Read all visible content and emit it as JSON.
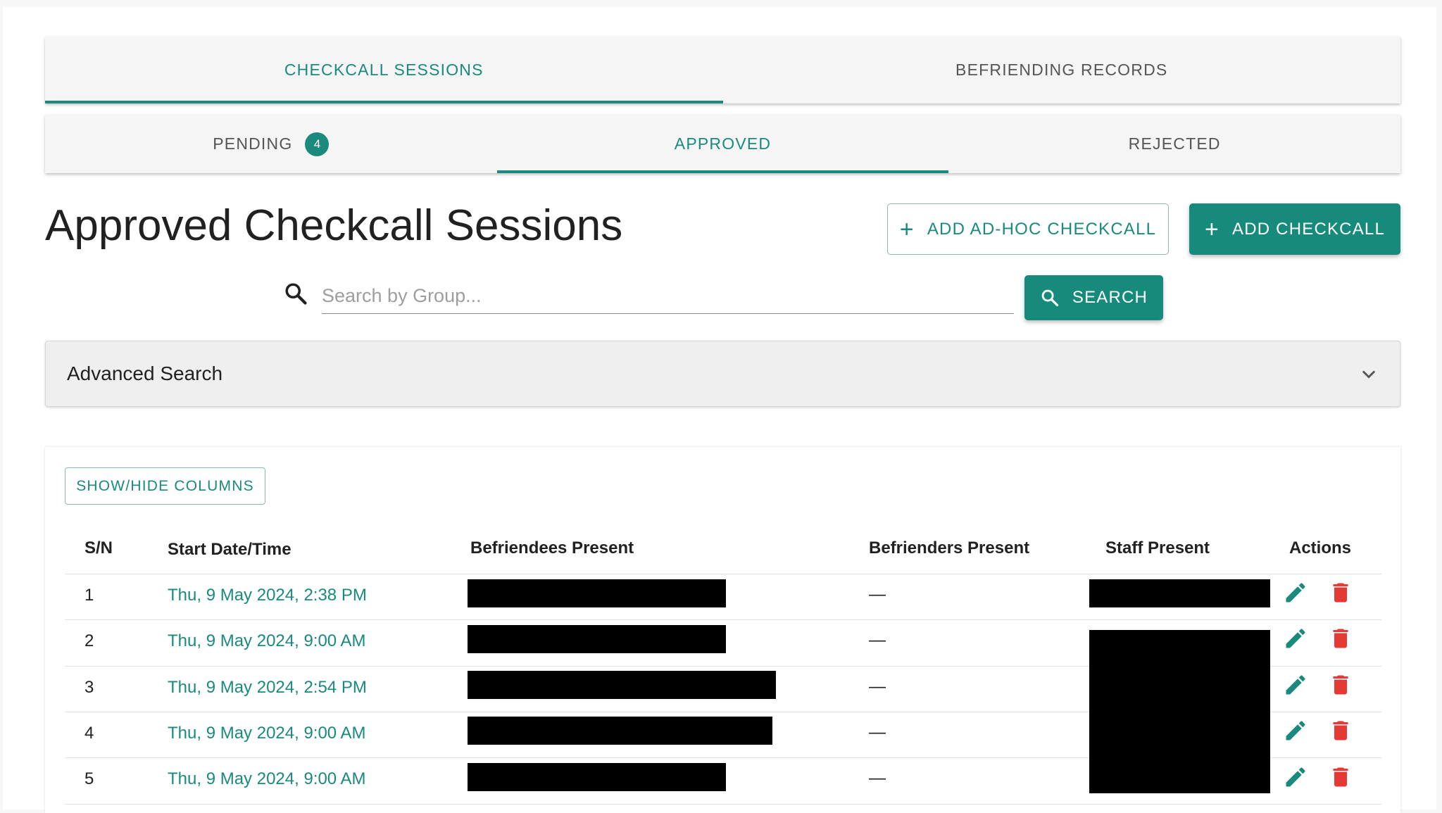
{
  "tabs": [
    {
      "label": "CHECKCALL SESSIONS",
      "active": true
    },
    {
      "label": "BEFRIENDING RECORDS",
      "active": false
    }
  ],
  "subtabs": [
    {
      "label": "PENDING",
      "badge": "4",
      "active": false
    },
    {
      "label": "APPROVED",
      "active": true
    },
    {
      "label": "REJECTED",
      "active": false
    }
  ],
  "page_title": "Approved Checkcall Sessions",
  "buttons": {
    "add_adhoc": "ADD AD-HOC CHECKCALL",
    "add_checkcall": "ADD CHECKCALL",
    "search": "SEARCH",
    "show_hide_columns": "SHOW/HIDE COLUMNS"
  },
  "search": {
    "placeholder": "Search by Group...",
    "value": ""
  },
  "advanced_search": {
    "label": "Advanced Search"
  },
  "table": {
    "headers": {
      "sn": "S/N",
      "start": "Start Date/Time",
      "befriendees": "Befriendees Present",
      "befrienders": "Befrienders Present",
      "staff": "Staff Present",
      "actions": "Actions"
    },
    "rows": [
      {
        "sn": "1",
        "start": "Thu, 9 May 2024, 2:38 PM",
        "befrienders": "—"
      },
      {
        "sn": "2",
        "start": "Thu, 9 May 2024, 9:00 AM",
        "befrienders": "—"
      },
      {
        "sn": "3",
        "start": "Thu, 9 May 2024, 2:54 PM",
        "befrienders": "—"
      },
      {
        "sn": "4",
        "start": "Thu, 9 May 2024, 9:00 AM",
        "befrienders": "—"
      },
      {
        "sn": "5",
        "start": "Thu, 9 May 2024, 9:00 AM",
        "befrienders": "—"
      }
    ]
  },
  "colors": {
    "accent": "#1a8a7c",
    "delete": "#e53935",
    "redaction": "#000000"
  },
  "icons": {
    "plus": "plus-icon",
    "search": "search-icon",
    "chevron": "chevron-down-icon",
    "edit": "pencil-icon",
    "delete": "trash-icon"
  }
}
